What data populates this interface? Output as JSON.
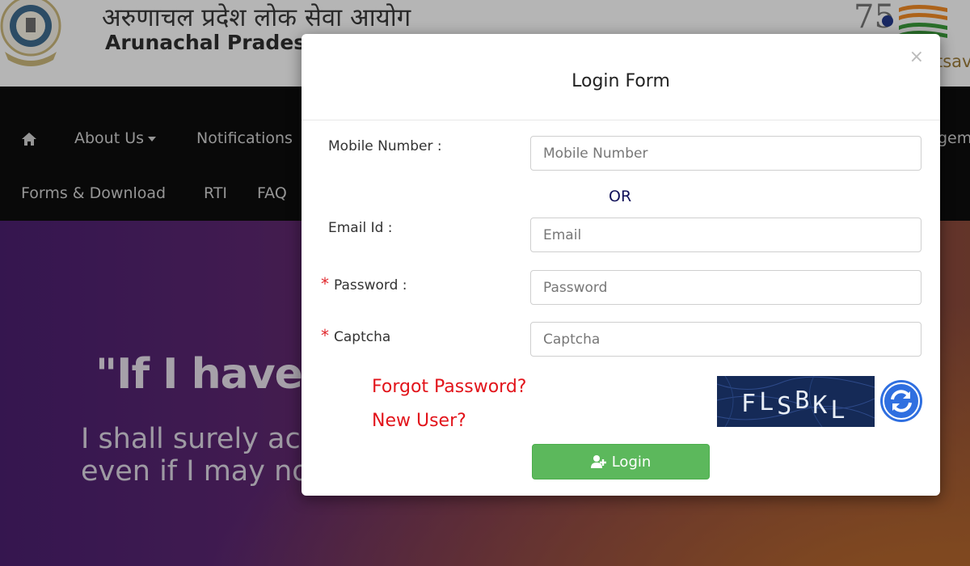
{
  "header": {
    "title_hindi": "अरुणाचल प्रदेश लोक सेवा आयोग",
    "title_english": "Arunachal Pradesh Public Service Commission",
    "azadi_partial_text": "tsav"
  },
  "nav": {
    "home_icon": "home-icon",
    "items": [
      "About Us",
      "Notifications",
      "Forms & Download",
      "RTI",
      "FAQ"
    ],
    "partial_right": "gem"
  },
  "hero": {
    "quote": "\"If I have the belief that I can do it,",
    "line1": "I shall surely acquire the capacity to do it",
    "line2": "even if I may not have it at the beginning.\""
  },
  "modal": {
    "title": "Login Form",
    "close_symbol": "×",
    "mobile_label": "Mobile Number :",
    "mobile_placeholder": "Mobile Number",
    "or_text": "OR",
    "email_label": "Email Id :",
    "email_placeholder": "Email",
    "password_label": "Password :",
    "password_placeholder": "Password",
    "captcha_label": "Captcha",
    "captcha_placeholder": "Captcha",
    "required_mark": "*",
    "forgot_link": "Forgot Password?",
    "new_user_link": "New User?",
    "captcha_code": "FLSBKL",
    "login_label": "Login"
  },
  "colors": {
    "required": "#e0262b",
    "link": "#e2141b",
    "login_button": "#5cb85c",
    "refresh_button": "#2f6fe0",
    "captcha_bg": "#152a57",
    "or_text": "#12125a"
  }
}
